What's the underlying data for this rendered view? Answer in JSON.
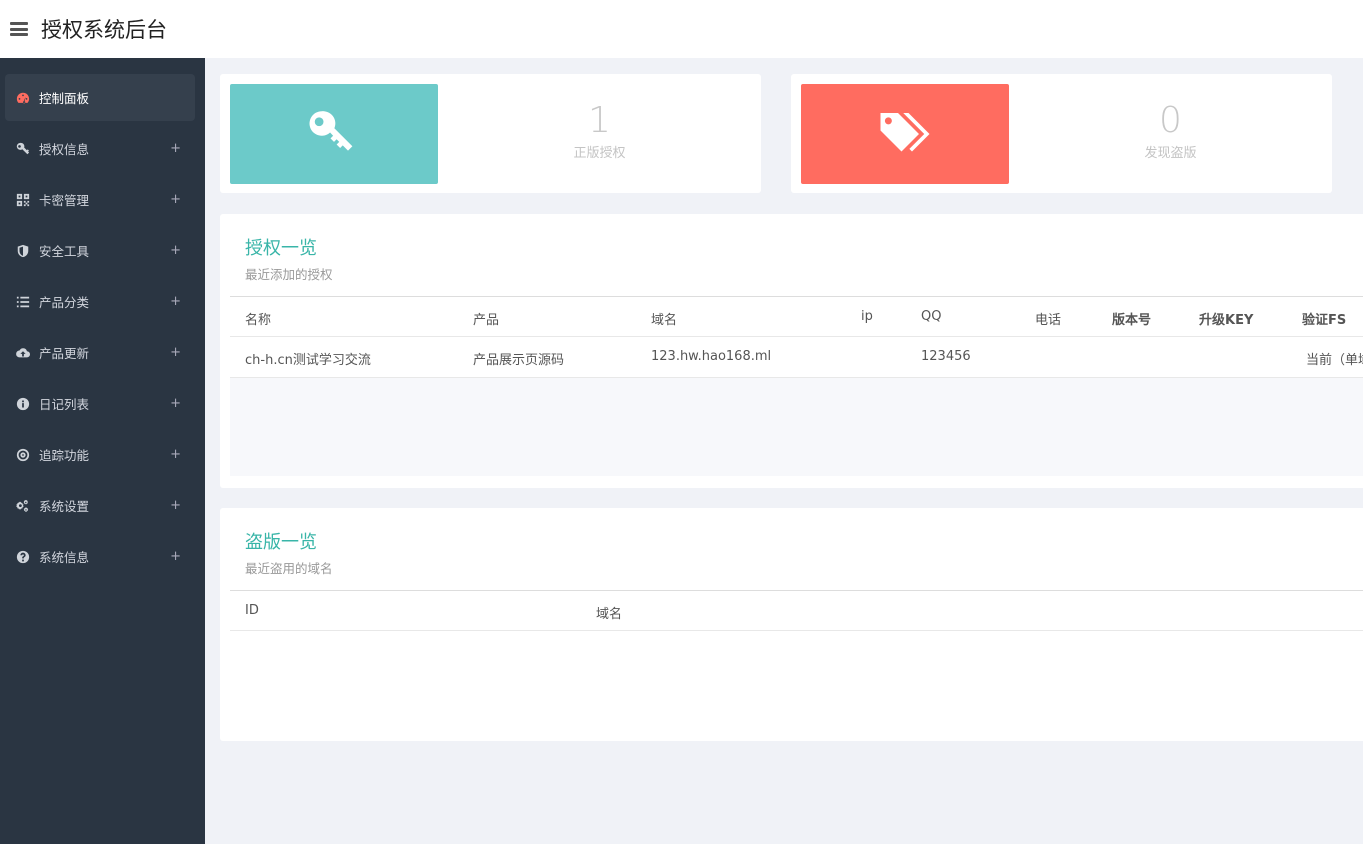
{
  "header": {
    "title": "授权系统后台",
    "menu_icon": "hamburger-icon"
  },
  "sidebar": {
    "items": [
      {
        "label": "控制面板",
        "icon": "dashboard-icon",
        "active": true
      },
      {
        "label": "授权信息",
        "icon": "key-icon",
        "expand": "+"
      },
      {
        "label": "卡密管理",
        "icon": "qrcode-icon",
        "expand": "+"
      },
      {
        "label": "安全工具",
        "icon": "shield-icon",
        "expand": "+"
      },
      {
        "label": "产品分类",
        "icon": "list-icon",
        "expand": "+"
      },
      {
        "label": "产品更新",
        "icon": "cloud-upload-icon",
        "expand": "+"
      },
      {
        "label": "日记列表",
        "icon": "info-icon",
        "expand": "+"
      },
      {
        "label": "追踪功能",
        "icon": "target-icon",
        "expand": "+"
      },
      {
        "label": "系统设置",
        "icon": "gears-icon",
        "expand": "+"
      },
      {
        "label": "系统信息",
        "icon": "question-icon",
        "expand": "+"
      }
    ]
  },
  "stats": [
    {
      "value": "1",
      "label": "正版授权",
      "color": "#6ccac9",
      "icon": "key-icon"
    },
    {
      "value": "0",
      "label": "发现盗版",
      "color": "#ff6c60",
      "icon": "tags-icon"
    }
  ],
  "auth_panel": {
    "title": "授权一览",
    "subtitle": "最近添加的授权",
    "columns": [
      "名称",
      "产品",
      "域名",
      "ip",
      "QQ",
      "电话",
      "版本号",
      "升级KEY",
      "验证FS"
    ],
    "rows": [
      [
        "ch-h.cn测试学习交流",
        "产品展示页源码",
        "123.hw.hao168.ml",
        "",
        "123456",
        "",
        "",
        "",
        "当前（单域"
      ]
    ]
  },
  "piracy_panel": {
    "title": "盗版一览",
    "subtitle": "最近盗用的域名",
    "columns": [
      "ID",
      "域名"
    ],
    "rows": []
  }
}
